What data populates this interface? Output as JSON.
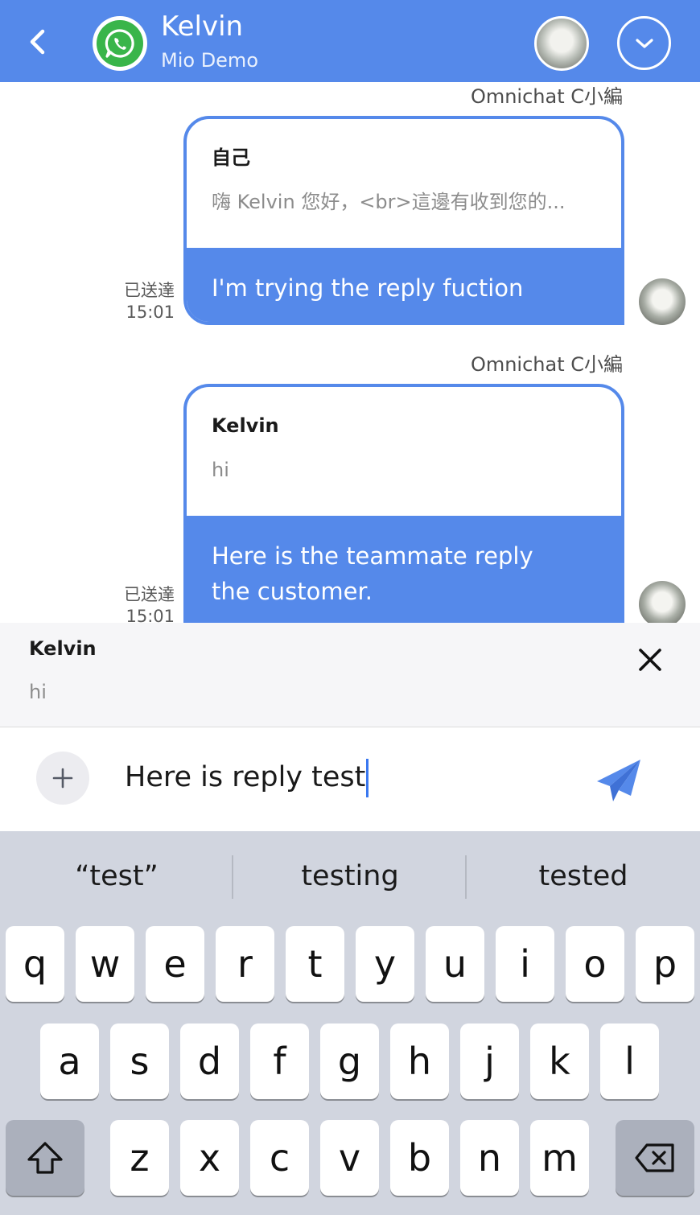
{
  "header": {
    "title": "Kelvin",
    "subtitle": "Mio Demo"
  },
  "messages": [
    {
      "sender": "Omnichat C小編",
      "quote_name": "自己",
      "quote_text": "嗨 Kelvin 您好，<br>這邊有收到您的...",
      "reply_text": "I'm trying the reply fuction",
      "status": "已送達",
      "time": "15:01"
    },
    {
      "sender": "Omnichat C小編",
      "quote_name": "Kelvin",
      "quote_text": "hi",
      "reply_text": "Here is the teammate reply the customer.",
      "status": "已送達",
      "time": "15:01"
    }
  ],
  "reply_preview": {
    "name": "Kelvin",
    "text": "hi"
  },
  "composer": {
    "value": "Here is reply test"
  },
  "keyboard": {
    "suggestions": [
      "“test”",
      "testing",
      "tested"
    ],
    "row1": [
      "q",
      "w",
      "e",
      "r",
      "t",
      "y",
      "u",
      "i",
      "o",
      "p"
    ],
    "row2": [
      "a",
      "s",
      "d",
      "f",
      "g",
      "h",
      "j",
      "k",
      "l"
    ],
    "row3": [
      "z",
      "x",
      "c",
      "v",
      "b",
      "n",
      "m"
    ]
  },
  "colors": {
    "brand": "#5589ea",
    "whatsapp": "#39b54a",
    "keyboard_bg": "#d1d5df"
  },
  "icons": {
    "back": "chevron-left-icon",
    "channel": "whatsapp-icon",
    "menu": "chevron-down-icon",
    "close": "close-icon",
    "attach": "plus-icon",
    "send": "paper-plane-icon",
    "shift": "shift-arrow-icon",
    "delete": "backspace-icon"
  }
}
